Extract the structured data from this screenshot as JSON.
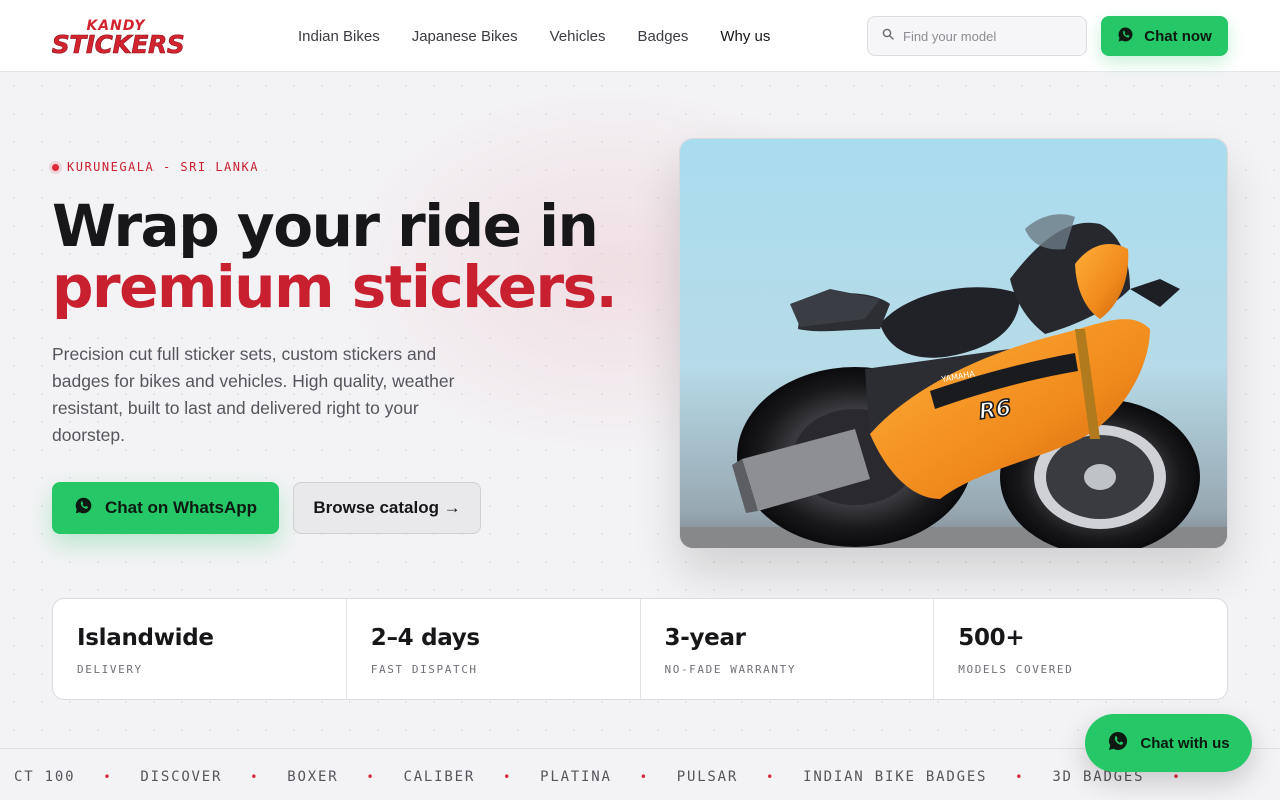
{
  "brand": {
    "logo_top": "KANDY",
    "logo_main": "STICKERS"
  },
  "nav": {
    "items": [
      {
        "label": "Indian Bikes"
      },
      {
        "label": "Japanese Bikes"
      },
      {
        "label": "Vehicles"
      },
      {
        "label": "Badges"
      },
      {
        "label": "Why us"
      }
    ]
  },
  "search": {
    "placeholder": "Find your model",
    "value": "",
    "icon": "search-icon"
  },
  "header_cta": {
    "label": "Chat now",
    "icon": "whatsapp-icon"
  },
  "hero": {
    "location": "KURUNEGALA - SRI LANKA",
    "title_line1": "Wrap your ride in",
    "title_line2": "premium stickers.",
    "description": "Precision cut full sticker sets, custom stickers and badges for bikes and vehicles. High quality, weather resistant, built to last and delivered right to your doorstep.",
    "primary_cta": "Chat on WhatsApp",
    "secondary_cta": "Browse catalog →",
    "image": {
      "subject": "orange-motorcycle-photo",
      "brand_text": "YAMAHA",
      "model_text": "R6"
    }
  },
  "stats": [
    {
      "value": "Islandwide",
      "label": "DELIVERY"
    },
    {
      "value": "2–4 days",
      "label": "FAST DISPATCH"
    },
    {
      "value": "3-year",
      "label": "NO-FADE WARRANTY"
    },
    {
      "value": "500+",
      "label": "MODELS COVERED"
    }
  ],
  "marquee": [
    "CT 100",
    "DISCOVER",
    "BOXER",
    "CALIBER",
    "PLATINA",
    "PULSAR",
    "INDIAN BIKE BADGES",
    "3D BADGES"
  ],
  "floating_cta": {
    "label": "Chat with us",
    "icon": "whatsapp-icon"
  },
  "colors": {
    "accent": "#c8202f",
    "whatsapp": "#25c766",
    "text": "#17171a",
    "background": "#f3f3f5"
  }
}
